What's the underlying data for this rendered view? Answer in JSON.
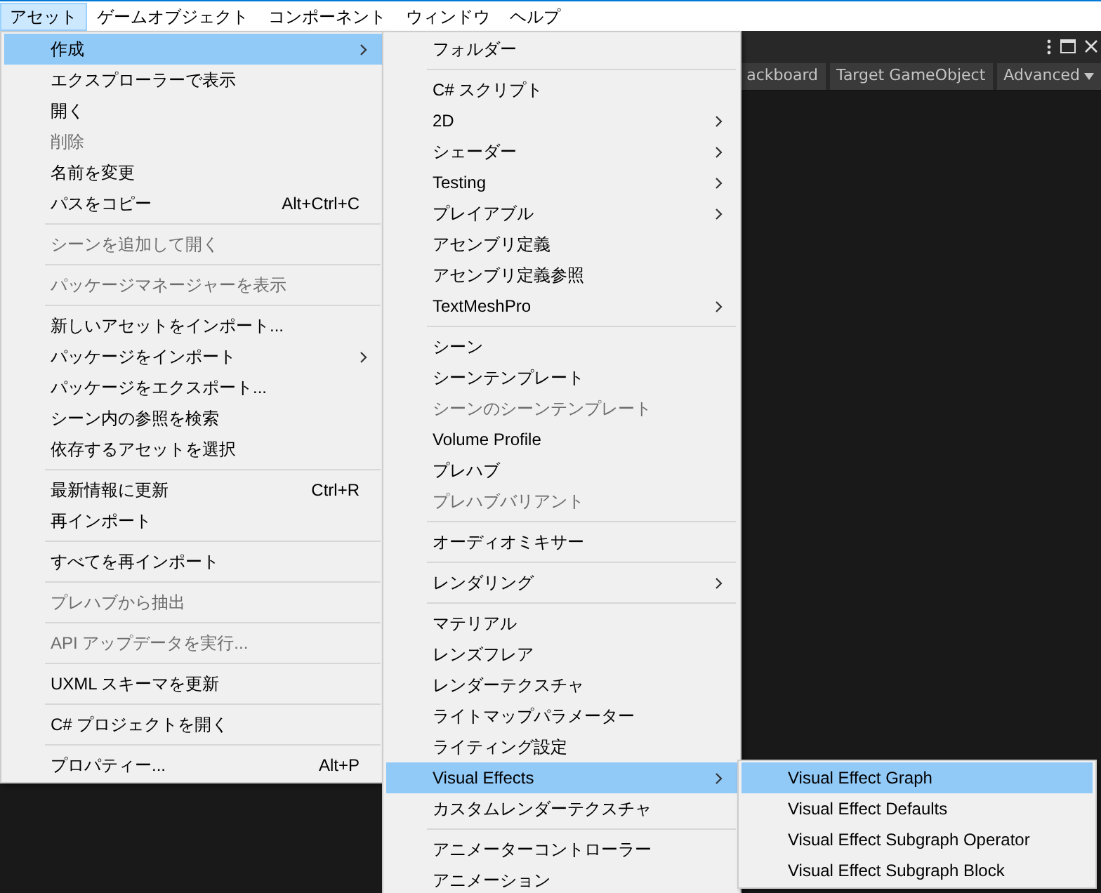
{
  "menubar": [
    {
      "label": "アセット",
      "selected": true
    },
    {
      "label": "ゲームオブジェクト",
      "selected": false
    },
    {
      "label": "コンポーネント",
      "selected": false
    },
    {
      "label": "ウィンドウ",
      "selected": false
    },
    {
      "label": "ヘルプ",
      "selected": false
    }
  ],
  "toolbar": {
    "buttons": [
      {
        "label": "ackboard",
        "kind": "button"
      },
      {
        "label": "Target GameObject",
        "kind": "button"
      },
      {
        "label": "Advanced",
        "kind": "dropdown"
      }
    ]
  },
  "menus": [
    {
      "items": [
        {
          "kind": "item",
          "label": "作成",
          "selected": true,
          "disabled": false,
          "submenu": true
        },
        {
          "kind": "item",
          "label": "エクスプローラーで表示",
          "selected": false,
          "disabled": false,
          "submenu": false
        },
        {
          "kind": "item",
          "label": "開く",
          "selected": false,
          "disabled": false,
          "submenu": false
        },
        {
          "kind": "item",
          "label": "削除",
          "selected": false,
          "disabled": true,
          "submenu": false
        },
        {
          "kind": "item",
          "label": "名前を変更",
          "selected": false,
          "disabled": false,
          "submenu": false
        },
        {
          "kind": "item",
          "label": "パスをコピー",
          "shortcut": "Alt+Ctrl+C",
          "selected": false,
          "disabled": false,
          "submenu": false
        },
        {
          "kind": "separator"
        },
        {
          "kind": "item",
          "label": "シーンを追加して開く",
          "selected": false,
          "disabled": true,
          "submenu": false
        },
        {
          "kind": "separator"
        },
        {
          "kind": "item",
          "label": "パッケージマネージャーを表示",
          "selected": false,
          "disabled": true,
          "submenu": false
        },
        {
          "kind": "separator"
        },
        {
          "kind": "item",
          "label": "新しいアセットをインポート...",
          "selected": false,
          "disabled": false,
          "submenu": false
        },
        {
          "kind": "item",
          "label": "パッケージをインポート",
          "selected": false,
          "disabled": false,
          "submenu": true
        },
        {
          "kind": "item",
          "label": "パッケージをエクスポート...",
          "selected": false,
          "disabled": false,
          "submenu": false
        },
        {
          "kind": "item",
          "label": "シーン内の参照を検索",
          "selected": false,
          "disabled": false,
          "submenu": false
        },
        {
          "kind": "item",
          "label": "依存するアセットを選択",
          "selected": false,
          "disabled": false,
          "submenu": false
        },
        {
          "kind": "separator"
        },
        {
          "kind": "item",
          "label": "最新情報に更新",
          "shortcut": "Ctrl+R",
          "selected": false,
          "disabled": false,
          "submenu": false
        },
        {
          "kind": "item",
          "label": "再インポート",
          "selected": false,
          "disabled": false,
          "submenu": false
        },
        {
          "kind": "separator"
        },
        {
          "kind": "item",
          "label": "すべてを再インポート",
          "selected": false,
          "disabled": false,
          "submenu": false
        },
        {
          "kind": "separator"
        },
        {
          "kind": "item",
          "label": "プレハブから抽出",
          "selected": false,
          "disabled": true,
          "submenu": false
        },
        {
          "kind": "separator"
        },
        {
          "kind": "item",
          "label": "API アップデータを実行...",
          "selected": false,
          "disabled": true,
          "submenu": false
        },
        {
          "kind": "separator"
        },
        {
          "kind": "item",
          "label": "UXML スキーマを更新",
          "selected": false,
          "disabled": false,
          "submenu": false
        },
        {
          "kind": "separator"
        },
        {
          "kind": "item",
          "label": "C# プロジェクトを開く",
          "selected": false,
          "disabled": false,
          "submenu": false
        },
        {
          "kind": "separator"
        },
        {
          "kind": "item",
          "label": "プロパティー...",
          "shortcut": "Alt+P",
          "selected": false,
          "disabled": false,
          "submenu": false
        }
      ]
    },
    {
      "items": [
        {
          "kind": "item",
          "label": "フォルダー",
          "selected": false,
          "disabled": false,
          "submenu": false
        },
        {
          "kind": "separator"
        },
        {
          "kind": "item",
          "label": "C# スクリプト",
          "selected": false,
          "disabled": false,
          "submenu": false
        },
        {
          "kind": "item",
          "label": "2D",
          "selected": false,
          "disabled": false,
          "submenu": true
        },
        {
          "kind": "item",
          "label": "シェーダー",
          "selected": false,
          "disabled": false,
          "submenu": true
        },
        {
          "kind": "item",
          "label": "Testing",
          "selected": false,
          "disabled": false,
          "submenu": true
        },
        {
          "kind": "item",
          "label": "プレイアブル",
          "selected": false,
          "disabled": false,
          "submenu": true
        },
        {
          "kind": "item",
          "label": "アセンブリ定義",
          "selected": false,
          "disabled": false,
          "submenu": false
        },
        {
          "kind": "item",
          "label": "アセンブリ定義参照",
          "selected": false,
          "disabled": false,
          "submenu": false
        },
        {
          "kind": "item",
          "label": "TextMeshPro",
          "selected": false,
          "disabled": false,
          "submenu": true
        },
        {
          "kind": "separator"
        },
        {
          "kind": "item",
          "label": "シーン",
          "selected": false,
          "disabled": false,
          "submenu": false
        },
        {
          "kind": "item",
          "label": "シーンテンプレート",
          "selected": false,
          "disabled": false,
          "submenu": false
        },
        {
          "kind": "item",
          "label": "シーンのシーンテンプレート",
          "selected": false,
          "disabled": true,
          "submenu": false
        },
        {
          "kind": "item",
          "label": "Volume Profile",
          "selected": false,
          "disabled": false,
          "submenu": false
        },
        {
          "kind": "item",
          "label": "プレハブ",
          "selected": false,
          "disabled": false,
          "submenu": false
        },
        {
          "kind": "item",
          "label": "プレハブバリアント",
          "selected": false,
          "disabled": true,
          "submenu": false
        },
        {
          "kind": "separator"
        },
        {
          "kind": "item",
          "label": "オーディオミキサー",
          "selected": false,
          "disabled": false,
          "submenu": false
        },
        {
          "kind": "separator"
        },
        {
          "kind": "item",
          "label": "レンダリング",
          "selected": false,
          "disabled": false,
          "submenu": true
        },
        {
          "kind": "separator"
        },
        {
          "kind": "item",
          "label": "マテリアル",
          "selected": false,
          "disabled": false,
          "submenu": false
        },
        {
          "kind": "item",
          "label": "レンズフレア",
          "selected": false,
          "disabled": false,
          "submenu": false
        },
        {
          "kind": "item",
          "label": "レンダーテクスチャ",
          "selected": false,
          "disabled": false,
          "submenu": false
        },
        {
          "kind": "item",
          "label": "ライトマップパラメーター",
          "selected": false,
          "disabled": false,
          "submenu": false
        },
        {
          "kind": "item",
          "label": "ライティング設定",
          "selected": false,
          "disabled": false,
          "submenu": false
        },
        {
          "kind": "item",
          "label": "Visual Effects",
          "selected": true,
          "disabled": false,
          "submenu": true
        },
        {
          "kind": "item",
          "label": "カスタムレンダーテクスチャ",
          "selected": false,
          "disabled": false,
          "submenu": false
        },
        {
          "kind": "separator"
        },
        {
          "kind": "item",
          "label": "アニメーターコントローラー",
          "selected": false,
          "disabled": false,
          "submenu": false
        },
        {
          "kind": "item",
          "label": "アニメーション",
          "selected": false,
          "disabled": false,
          "submenu": false
        }
      ]
    },
    {
      "items": [
        {
          "kind": "item",
          "label": "Visual Effect Graph",
          "selected": true,
          "disabled": false,
          "submenu": false
        },
        {
          "kind": "item",
          "label": "Visual Effect Defaults",
          "selected": false,
          "disabled": false,
          "submenu": false
        },
        {
          "kind": "item",
          "label": "Visual Effect Subgraph Operator",
          "selected": false,
          "disabled": false,
          "submenu": false
        },
        {
          "kind": "item",
          "label": "Visual Effect Subgraph Block",
          "selected": false,
          "disabled": false,
          "submenu": false
        }
      ]
    }
  ]
}
